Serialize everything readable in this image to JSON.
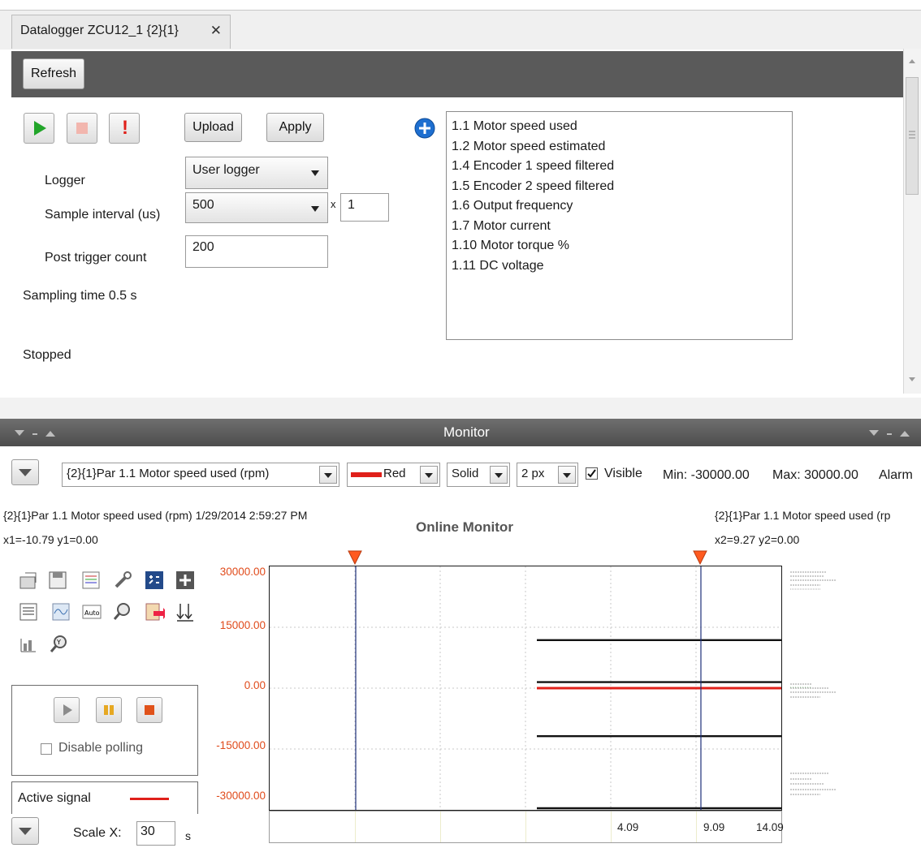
{
  "window": {
    "tab_title": "Datalogger ZCU12_1 {2}{1}",
    "tab_close": "✕"
  },
  "toolbar": {
    "refresh_label": "Refresh"
  },
  "controls": {
    "upload_label": "Upload",
    "apply_label": "Apply",
    "stop_mark": "!"
  },
  "settings": {
    "logger_label": "Logger",
    "logger_value": "User logger",
    "sample_interval_label": "Sample interval (us)",
    "sample_interval_value": "500",
    "multiplier_sep": "x",
    "multiplier_value": "1",
    "post_trigger_label": "Post trigger count",
    "post_trigger_value": "200",
    "sampling_time": "Sampling time 0.5 s",
    "status": "Stopped"
  },
  "signals": [
    "1.1 Motor speed used",
    "1.2 Motor speed estimated",
    "1.4 Encoder 1 speed filtered",
    "1.5 Encoder 2 speed filtered",
    "1.6 Output frequency",
    "1.7 Motor current",
    "1.10 Motor torque %",
    "1.11 DC voltage"
  ],
  "monitor": {
    "title": "Monitor",
    "header_controls": "- ",
    "signal_select": "{2}{1}Par 1.1 Motor speed used (rpm)",
    "color_select": "Red",
    "line_style": "Solid",
    "line_width": "2 px",
    "visible_label": "Visible",
    "visible_checked": true,
    "min_text": "Min: -30000.00",
    "max_text": "Max: 30000.00",
    "alarm_text": "Alarm",
    "cursor1_title": "{2}{1}Par 1.1 Motor speed used (rpm) 1/29/2014 2:59:27 PM",
    "cursor1_xy": "x1=-10.79 y1=0.00",
    "cursor2_title": "{2}{1}Par 1.1 Motor speed used (rp",
    "cursor2_xy": "x2=9.27 y2=0.00",
    "chart_title": "Online Monitor",
    "polling_label": "Disable polling",
    "active_signal_label": "Active signal",
    "scale_x_label": "Scale X:",
    "scale_x_value": "30",
    "scale_x_unit": "s",
    "colors": {
      "active_signal": "#e0201a",
      "cursor_marker": "#ff5a1f",
      "y_labels": "#e04b1b"
    }
  },
  "chart_data": {
    "type": "line",
    "title": "Online Monitor",
    "ylim": [
      -30000,
      30000
    ],
    "y_ticks": [
      "30000.00",
      "15000.00",
      "0.00",
      "-15000.00",
      "-30000.00"
    ],
    "x_ticks": [
      "4.09",
      "9.09",
      "14.09"
    ],
    "cursors": {
      "x1": -10.79,
      "x2": 9.27
    },
    "series": [
      {
        "name": "{2}{1}Par 1.1 Motor speed used (rpm)",
        "color": "#e0201a",
        "values": [
          0,
          0
        ]
      },
      {
        "color": "#111111",
        "values": [
          12000,
          12000
        ]
      },
      {
        "color": "#111111",
        "values": [
          1500,
          1500
        ]
      },
      {
        "color": "#111111",
        "values": [
          -12000,
          -12000
        ]
      },
      {
        "color": "#111111",
        "values": [
          -30000,
          -30000
        ]
      }
    ],
    "grid": true
  }
}
